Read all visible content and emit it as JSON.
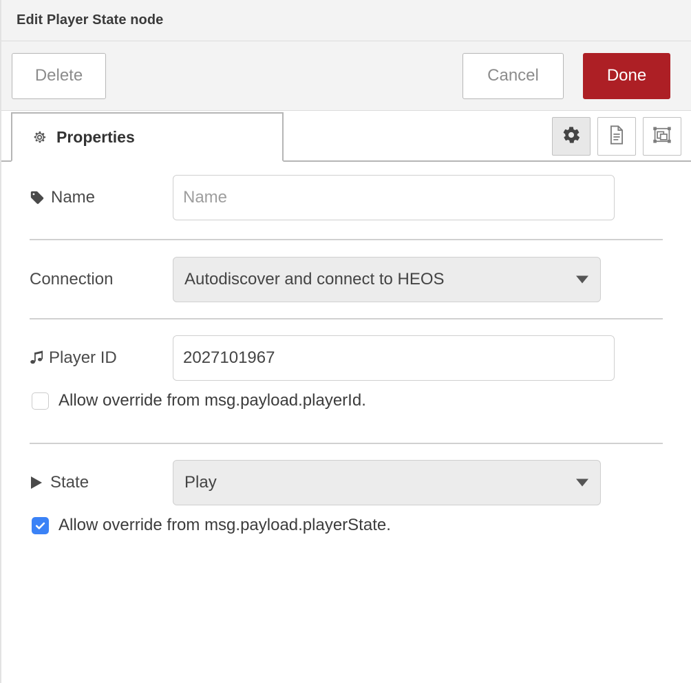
{
  "dialog": {
    "title": "Edit Player State node"
  },
  "toolbar": {
    "delete_label": "Delete",
    "cancel_label": "Cancel",
    "done_label": "Done",
    "done_color": "#ad1f25"
  },
  "tabs": [
    {
      "label": "Properties",
      "icon": "gear-icon",
      "active": true
    }
  ],
  "tab_icon_buttons": [
    {
      "name": "properties-gear-icon",
      "active": true
    },
    {
      "name": "description-document-icon",
      "active": false
    },
    {
      "name": "appearance-layout-icon",
      "active": false
    }
  ],
  "form": {
    "name_row": {
      "label": "Name",
      "icon": "tag-icon",
      "value": "",
      "placeholder": "Name"
    },
    "connection_row": {
      "label": "Connection",
      "selected": "Autodiscover and connect to HEOS"
    },
    "player_id_row": {
      "label": "Player ID",
      "icon": "music-note-icon",
      "value": "2027101967",
      "override": {
        "label": "Allow override from msg.payload.playerId.",
        "checked": false
      }
    },
    "state_row": {
      "label": "State",
      "icon": "play-triangle-icon",
      "selected": "Play",
      "override": {
        "label": "Allow override from msg.payload.playerState.",
        "checked": true
      }
    }
  },
  "colors": {
    "accent_checkbox": "#3b82f6",
    "done_button": "#ad1f25",
    "header_background": "#f3f3f3",
    "divider": "#d0d0d0"
  }
}
